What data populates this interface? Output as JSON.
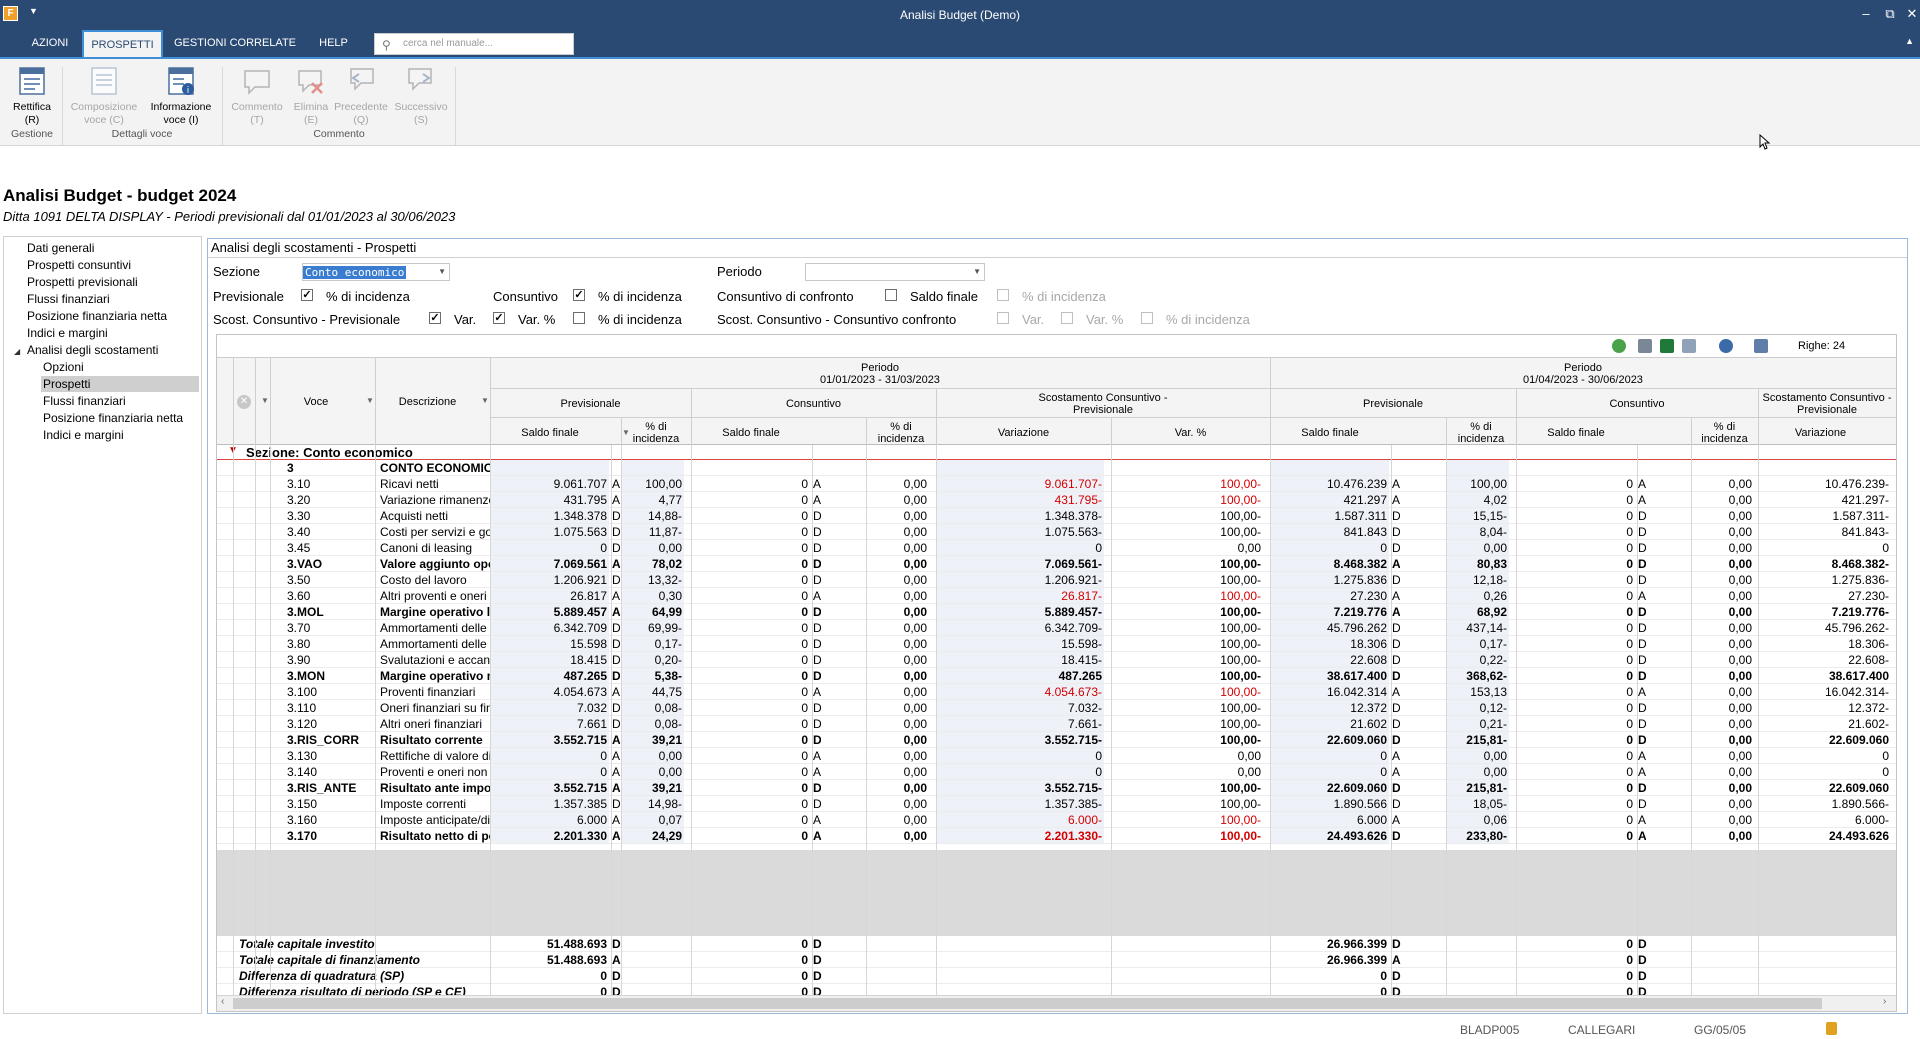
{
  "window": {
    "title": "Analisi Budget  (Demo)",
    "app_icon": "F",
    "min": "–",
    "max": "⧉",
    "close": "✕"
  },
  "ribbon_tabs": [
    {
      "label": "AZIONI"
    },
    {
      "label": "PROSPETTI"
    },
    {
      "label": "GESTIONI CORRELATE"
    },
    {
      "label": "HELP"
    }
  ],
  "search": {
    "placeholder": "cerca nel manuale..."
  },
  "ribbon": {
    "buttons": [
      {
        "label": "Rettifica",
        "key": "(R)",
        "enabled": true,
        "icon": "rettifica-icon"
      },
      {
        "label": "Composizione",
        "label2": "voce (C)",
        "enabled": false,
        "icon": "composizione-icon"
      },
      {
        "label": "Informazione",
        "label2": "voce (I)",
        "enabled": true,
        "icon": "informazione-icon"
      },
      {
        "label": "Commento",
        "key": "(T)",
        "enabled": false,
        "icon": "comment-icon"
      },
      {
        "label": "Elimina",
        "key": "(E)",
        "enabled": false,
        "icon": "delete-comment-icon"
      },
      {
        "label": "Precedente",
        "key": "(Q)",
        "enabled": false,
        "icon": "previous-comment-icon"
      },
      {
        "label": "Successivo",
        "key": "(S)",
        "enabled": false,
        "icon": "next-comment-icon"
      }
    ],
    "groups": [
      "Gestione",
      "Dettagli voce",
      "Commento"
    ]
  },
  "page": {
    "title": "Analisi Budget - budget 2024",
    "subtitle": "Ditta 1091 DELTA DISPLAY - Periodi previsionali dal 01/01/2023 al 30/06/2023"
  },
  "nav": {
    "items": [
      "Dati generali",
      "Prospetti consuntivi",
      "Prospetti previsionali",
      "Flussi finanziari",
      "Posizione finanziaria netta",
      "Indici e margini",
      "Analisi degli scostamenti",
      "Opzioni",
      "Prospetti",
      "Flussi finanziari",
      "Posizione finanziaria netta",
      "Indici e margini"
    ],
    "selected": "Prospetti"
  },
  "panel": {
    "title": "Analisi degli scostamenti - Prospetti"
  },
  "filters": {
    "sezione_label": "Sezione",
    "sezione_value": "Conto economico",
    "periodo_label": "Periodo",
    "periodo_value": "",
    "previsionale": "Previsionale",
    "consuntivo": "Consuntivo",
    "consuntivo_confronto": "Consuntivo di confronto",
    "saldo_finale": "Saldo finale",
    "pct_incidenza": "% di incidenza",
    "scost_cp": "Scost. Consuntivo - Previsionale",
    "scost_cc": "Scost. Consuntivo - Consuntivo confronto",
    "var": "Var.",
    "var_pct": "Var. %",
    "checks": {
      "prev_pct": true,
      "cons_pct": true,
      "confronto_saldo": false,
      "confronto_pct": false,
      "scost_cp": true,
      "scost_var": true,
      "scost_varpct": false,
      "scost_cp_pct": false,
      "scost_cc": false,
      "scost_cc_var": false,
      "scost_cc_varpct": false,
      "scost_cc_pct": false
    }
  },
  "grid": {
    "righe": "Righe: 24",
    "headers": {
      "voce": "Voce",
      "descrizione": "Descrizione",
      "periodo": "Periodo",
      "period1": "01/01/2023 - 31/03/2023",
      "period2": "01/04/2023 - 30/06/2023",
      "previsionale": "Previsionale",
      "consuntivo": "Consuntivo",
      "scostamento": "Scostamento Consuntivo -",
      "scostamento2": "Previsionale",
      "saldo_finale": "Saldo finale",
      "pct_di": "% di",
      "incidenza": "incidenza",
      "variazione": "Variazione",
      "var_pct": "Var. %"
    },
    "section": "Sezione:  Conto economico",
    "rows": [
      {
        "voce": "3",
        "desc": "CONTO ECONOMICO",
        "b": true,
        "cells": [
          "",
          "",
          "",
          "",
          "",
          "",
          "",
          "",
          "",
          "",
          "",
          "",
          "",
          "",
          "",
          "",
          ""
        ]
      },
      {
        "voce": "3.10",
        "desc": "Ricavi netti",
        "b": false,
        "cells": [
          "9.061.707",
          "A",
          "100,00",
          "0",
          "A",
          "0,00",
          "9.061.707-",
          "100,00-",
          "10.476.239",
          "A",
          "100,00",
          "0",
          "A",
          "0,00",
          "10.476.239-"
        ],
        "red": [
          6,
          7
        ]
      },
      {
        "voce": "3.20",
        "desc": "Variazione rimanenze",
        "b": false,
        "cells": [
          "431.795",
          "A",
          "4,77",
          "0",
          "A",
          "0,00",
          "431.795-",
          "100,00-",
          "421.297",
          "A",
          "4,02",
          "0",
          "A",
          "0,00",
          "421.297-"
        ],
        "red": [
          6,
          7
        ]
      },
      {
        "voce": "3.30",
        "desc": "Acquisti netti",
        "b": false,
        "cells": [
          "1.348.378",
          "D",
          "14,88-",
          "0",
          "D",
          "0,00",
          "1.348.378-",
          "100,00-",
          "1.587.311",
          "D",
          "15,15-",
          "0",
          "D",
          "0,00",
          "1.587.311-"
        ],
        "red": []
      },
      {
        "voce": "3.40",
        "desc": "Costi per servizi e godimento",
        "b": false,
        "cells": [
          "1.075.563",
          "D",
          "11,87-",
          "0",
          "D",
          "0,00",
          "1.075.563-",
          "100,00-",
          "841.843",
          "D",
          "8,04-",
          "0",
          "D",
          "0,00",
          "841.843-"
        ],
        "red": []
      },
      {
        "voce": "3.45",
        "desc": "Canoni di leasing",
        "b": false,
        "cells": [
          "0",
          "D",
          "0,00",
          "0",
          "D",
          "0,00",
          "0",
          "0,00",
          "0",
          "D",
          "0,00",
          "0",
          "D",
          "0,00",
          "0"
        ],
        "red": []
      },
      {
        "voce": "3.VAO",
        "desc": "Valore aggiunto operativo",
        "b": true,
        "cells": [
          "7.069.561",
          "A",
          "78,02",
          "0",
          "D",
          "0,00",
          "7.069.561-",
          "100,00-",
          "8.468.382",
          "A",
          "80,83",
          "0",
          "D",
          "0,00",
          "8.468.382-"
        ],
        "red": []
      },
      {
        "voce": "3.50",
        "desc": "Costo del lavoro",
        "b": false,
        "cells": [
          "1.206.921",
          "D",
          "13,32-",
          "0",
          "D",
          "0,00",
          "1.206.921-",
          "100,00-",
          "1.275.836",
          "D",
          "12,18-",
          "0",
          "D",
          "0,00",
          "1.275.836-"
        ],
        "red": []
      },
      {
        "voce": "3.60",
        "desc": "Altri proventi e oneri operativi",
        "b": false,
        "cells": [
          "26.817",
          "A",
          "0,30",
          "0",
          "A",
          "0,00",
          "26.817-",
          "100,00-",
          "27.230",
          "A",
          "0,26",
          "0",
          "A",
          "0,00",
          "27.230-"
        ],
        "red": [
          6,
          7
        ]
      },
      {
        "voce": "3.MOL",
        "desc": "Margine operativo lordo",
        "b": true,
        "cells": [
          "5.889.457",
          "A",
          "64,99",
          "0",
          "D",
          "0,00",
          "5.889.457-",
          "100,00-",
          "7.219.776",
          "A",
          "68,92",
          "0",
          "D",
          "0,00",
          "7.219.776-"
        ],
        "red": []
      },
      {
        "voce": "3.70",
        "desc": "Ammortamenti delle immobilizzazioni",
        "b": false,
        "cells": [
          "6.342.709",
          "D",
          "69,99-",
          "0",
          "D",
          "0,00",
          "6.342.709-",
          "100,00-",
          "45.796.262",
          "D",
          "437,14-",
          "0",
          "D",
          "0,00",
          "45.796.262-"
        ],
        "red": []
      },
      {
        "voce": "3.80",
        "desc": "Ammortamenti delle immobilizzazioni",
        "b": false,
        "cells": [
          "15.598",
          "D",
          "0,17-",
          "0",
          "D",
          "0,00",
          "15.598-",
          "100,00-",
          "18.306",
          "D",
          "0,17-",
          "0",
          "D",
          "0,00",
          "18.306-"
        ],
        "red": []
      },
      {
        "voce": "3.90",
        "desc": "Svalutazioni e accantonamenti",
        "b": false,
        "cells": [
          "18.415",
          "D",
          "0,20-",
          "0",
          "D",
          "0,00",
          "18.415-",
          "100,00-",
          "22.608",
          "D",
          "0,22-",
          "0",
          "D",
          "0,00",
          "22.608-"
        ],
        "red": []
      },
      {
        "voce": "3.MON",
        "desc": "Margine operativo netto",
        "b": true,
        "cells": [
          "487.265",
          "D",
          "5,38-",
          "0",
          "D",
          "0,00",
          "487.265",
          "100,00-",
          "38.617.400",
          "D",
          "368,62-",
          "0",
          "D",
          "0,00",
          "38.617.400"
        ],
        "red": []
      },
      {
        "voce": "3.100",
        "desc": "Proventi finanziari",
        "b": false,
        "cells": [
          "4.054.673",
          "A",
          "44,75",
          "0",
          "A",
          "0,00",
          "4.054.673-",
          "100,00-",
          "16.042.314",
          "A",
          "153,13",
          "0",
          "A",
          "0,00",
          "16.042.314-"
        ],
        "red": [
          6,
          7
        ]
      },
      {
        "voce": "3.110",
        "desc": "Oneri finanziari su finanziamenti",
        "b": false,
        "cells": [
          "7.032",
          "D",
          "0,08-",
          "0",
          "D",
          "0,00",
          "7.032-",
          "100,00-",
          "12.372",
          "D",
          "0,12-",
          "0",
          "D",
          "0,00",
          "12.372-"
        ],
        "red": []
      },
      {
        "voce": "3.120",
        "desc": "Altri oneri finanziari",
        "b": false,
        "cells": [
          "7.661",
          "D",
          "0,08-",
          "0",
          "D",
          "0,00",
          "7.661-",
          "100,00-",
          "21.602",
          "D",
          "0,21-",
          "0",
          "D",
          "0,00",
          "21.602-"
        ],
        "red": []
      },
      {
        "voce": "3.RIS_CORR",
        "desc": "Risultato corrente",
        "b": true,
        "cells": [
          "3.552.715",
          "A",
          "39,21",
          "0",
          "D",
          "0,00",
          "3.552.715-",
          "100,00-",
          "22.609.060",
          "D",
          "215,81-",
          "0",
          "D",
          "0,00",
          "22.609.060"
        ],
        "red": []
      },
      {
        "voce": "3.130",
        "desc": "Rettifiche di valore di attività/passività",
        "b": false,
        "cells": [
          "0",
          "A",
          "0,00",
          "0",
          "A",
          "0,00",
          "0",
          "0,00",
          "0",
          "A",
          "0,00",
          "0",
          "A",
          "0,00",
          "0"
        ],
        "red": []
      },
      {
        "voce": "3.140",
        "desc": "Proventi e oneri non ricorrenti",
        "b": false,
        "cells": [
          "0",
          "A",
          "0,00",
          "0",
          "A",
          "0,00",
          "0",
          "0,00",
          "0",
          "A",
          "0,00",
          "0",
          "A",
          "0,00",
          "0"
        ],
        "red": []
      },
      {
        "voce": "3.RIS_ANTE",
        "desc": "Risultato ante imposte",
        "b": true,
        "cells": [
          "3.552.715",
          "A",
          "39,21",
          "0",
          "D",
          "0,00",
          "3.552.715-",
          "100,00-",
          "22.609.060",
          "D",
          "215,81-",
          "0",
          "D",
          "0,00",
          "22.609.060"
        ],
        "red": []
      },
      {
        "voce": "3.150",
        "desc": "Imposte correnti",
        "b": false,
        "cells": [
          "1.357.385",
          "D",
          "14,98-",
          "0",
          "D",
          "0,00",
          "1.357.385-",
          "100,00-",
          "1.890.566",
          "D",
          "18,05-",
          "0",
          "D",
          "0,00",
          "1.890.566-"
        ],
        "red": []
      },
      {
        "voce": "3.160",
        "desc": "Imposte anticipate/differite",
        "b": false,
        "cells": [
          "6.000",
          "A",
          "0,07",
          "0",
          "A",
          "0,00",
          "6.000-",
          "100,00-",
          "6.000",
          "A",
          "0,06",
          "0",
          "A",
          "0,00",
          "6.000-"
        ],
        "red": [
          6,
          7
        ]
      },
      {
        "voce": "3.170",
        "desc": "Risultato netto di periodo",
        "b": true,
        "cells": [
          "2.201.330",
          "A",
          "24,29",
          "0",
          "A",
          "0,00",
          "2.201.330-",
          "100,00-",
          "24.493.626",
          "D",
          "233,80-",
          "0",
          "A",
          "0,00",
          "24.493.626"
        ],
        "red": [
          6,
          7
        ]
      }
    ],
    "totals": [
      {
        "label": "Totale capitale investito",
        "v1": "51.488.693",
        "s1": "D",
        "v2": "0",
        "s2": "D",
        "v3": "26.966.399",
        "s3": "D",
        "v4": "0",
        "s4": "D"
      },
      {
        "label": "Totale capitale di finanziamento",
        "v1": "51.488.693",
        "s1": "A",
        "v2": "0",
        "s2": "D",
        "v3": "26.966.399",
        "s3": "A",
        "v4": "0",
        "s4": "D"
      },
      {
        "label": "Differenza di quadratura (SP)",
        "v1": "0",
        "s1": "D",
        "v2": "0",
        "s2": "D",
        "v3": "0",
        "s3": "D",
        "v4": "0",
        "s4": "D"
      },
      {
        "label": "Differenza risultato di periodo (SP e CE)",
        "v1": "0",
        "s1": "D",
        "v2": "0",
        "s2": "D",
        "v3": "0",
        "s3": "D",
        "v4": "0",
        "s4": "D"
      }
    ]
  },
  "status": {
    "db": "BLADP005",
    "user": "CALLEGARI",
    "date": "GG/05/05"
  },
  "colors": {
    "titlebar": "#2b4a73",
    "accent": "#3f8fd8",
    "red": "#d40000",
    "selected_nav": "#cfcfcf"
  }
}
